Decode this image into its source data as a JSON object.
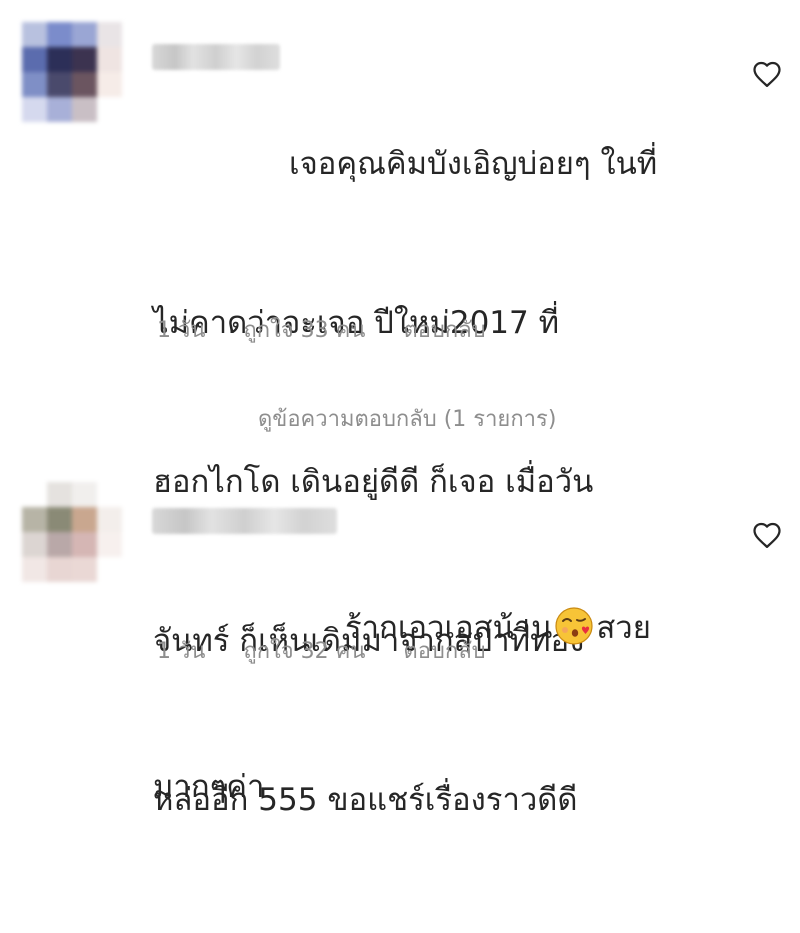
{
  "comments": [
    {
      "text_lines": [
        "เจอคุณคิมบังเอิญบ่อยๆ ในที่",
        "ไม่คาดว่าจะเจอ ปีใหม่2017 ที่",
        "ฮอกไกโด เดินอยู่ดีดี ก็เจอ เมื่อวัน",
        "จันทร์ ก็เห็นเดิมมาจากสปาที่ทอง",
        "หล่ออีก 555 ขอแชร์เรื่องราวดีดี"
      ],
      "time": "1 วัน",
      "likes": "ถูกใจ 33 คน",
      "reply": "ตอบกลับ",
      "view_replies": "ดูข้อความตอบกลับ (1 รายการ)"
    },
    {
      "text_before_emoji": "ร้ากเอวเอสน้าน",
      "emoji": "face-blowing-kiss-emoji",
      "text_after_emoji": "สวย",
      "text_line2": "มากๆค่า",
      "time": "1 วัน",
      "likes": "ถูกใจ 32 คน",
      "reply": "ตอบกลับ"
    }
  ],
  "icons": {
    "like": "heart-outline-icon"
  },
  "colors": {
    "text": "#262626",
    "secondary": "#8e8e8e",
    "background": "#ffffff"
  }
}
